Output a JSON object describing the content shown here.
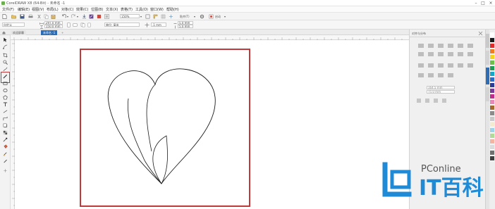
{
  "title_bar": {
    "app_title": "CorelDRAW X8 (64-Bit) - 未命名 -1"
  },
  "menu": {
    "items": [
      "文件(F)",
      "编辑(E)",
      "视图(V)",
      "布局(L)",
      "对象(C)",
      "效果(C)",
      "位图(B)",
      "文本(X)",
      "表格(T)",
      "工具(O)",
      "窗口(W)",
      "帮助(H)"
    ]
  },
  "toolbar": {
    "zoom_value": "150%",
    "snap_label": "贴齐(T)",
    "launch_label": "启动"
  },
  "property_bar": {
    "page_size": "自定义",
    "width_value": "297.0 mm",
    "height_value": "150.0 mm",
    "units_label": "单位: 毫米",
    "nudge_value": ".1 mm",
    "dup_x_value": "5.0 mm",
    "dup_y_value": "5.0 mm"
  },
  "tabs": {
    "welcome": "欢迎屏幕",
    "document": "未命名 -1"
  },
  "right_panel": {
    "header": "对齐与分布",
    "dim_w": "164.5 mm",
    "dim_h": "75.0 mm"
  },
  "watermark": {
    "brand": "PConline",
    "site": "IT百科"
  },
  "colors": {
    "highlight_red": "#c0393b",
    "accent_blue": "#2d6db5",
    "watermark_blue": "#1f8bd6"
  },
  "palette_colors": [
    "#ffffff",
    "#1a1a1a",
    "#e22b2b",
    "#f07d1f",
    "#f7d21c",
    "#6cc04a",
    "#1e9c54",
    "#14a7c7",
    "#2c6cc8",
    "#2b3c96",
    "#7a3b98",
    "#c12d8c",
    "#e988b7",
    "#a5692f",
    "#8b8b8b",
    "#c8c8c8",
    "#f5ead0",
    "#9fd3e8",
    "#b2d89a",
    "#f4b4a4",
    "#dcdcdc",
    "#707070",
    "#404040"
  ]
}
